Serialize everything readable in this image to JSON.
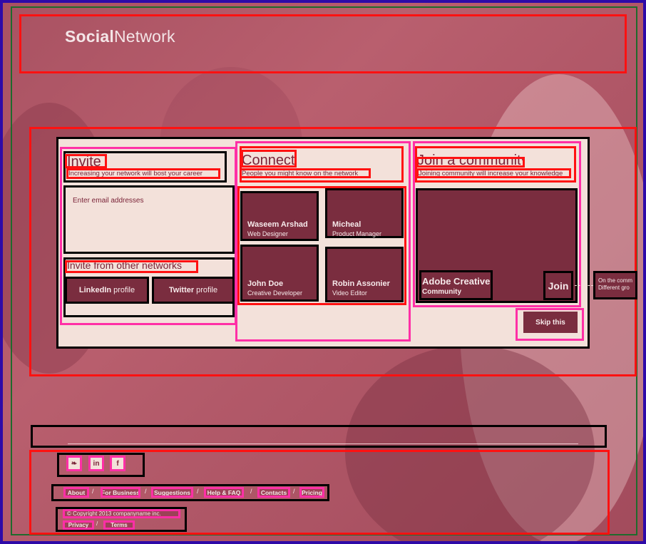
{
  "brand": {
    "logo_bold": "Social",
    "logo_rest": "Network"
  },
  "invite": {
    "title": "Invite",
    "subtitle": "Increasing your network will bost your career",
    "email_placeholder": "Enter email addresses",
    "other_title": "Invite from other networks",
    "buttons": [
      {
        "bold": "LinkedIn",
        "rest": "profile"
      },
      {
        "bold": "Twitter",
        "rest": "profile"
      }
    ]
  },
  "connect": {
    "title": "Connect",
    "subtitle": "People you might know on the network",
    "people": [
      {
        "name": "Waseem Arshad",
        "role": "Web Designer"
      },
      {
        "name": "Micheal",
        "role": "Product Manager"
      },
      {
        "name": "John Doe",
        "role": "Creative Developer"
      },
      {
        "name": "Robin Assonier",
        "role": "Video Editor"
      }
    ]
  },
  "community": {
    "title": "Join a community",
    "subtitle": "Joining community will increase your knowledge",
    "name_line1": "Adobe Creatives",
    "name_line2": "Community",
    "join_label": "Join",
    "tooltip_line1": "On the comm",
    "tooltip_line2": "Different gro",
    "skip_label": "Skip this"
  },
  "footer": {
    "social": [
      {
        "icon": "twitter-icon",
        "glyph": "❧"
      },
      {
        "icon": "linkedin-icon",
        "glyph": "in"
      },
      {
        "icon": "facebook-icon",
        "glyph": "f"
      }
    ],
    "links": [
      "About",
      "For Business",
      "Suggestions",
      "Help & FAQ",
      "Contacts",
      "Pricing"
    ],
    "separator": "/",
    "copyright": "© Copyright 2013 companyname inc.",
    "legal": [
      "Privacy",
      "Terms"
    ]
  },
  "colors": {
    "accent": "#7a2d3f",
    "panel": "#f3e1da",
    "overlay": "#b15868"
  }
}
